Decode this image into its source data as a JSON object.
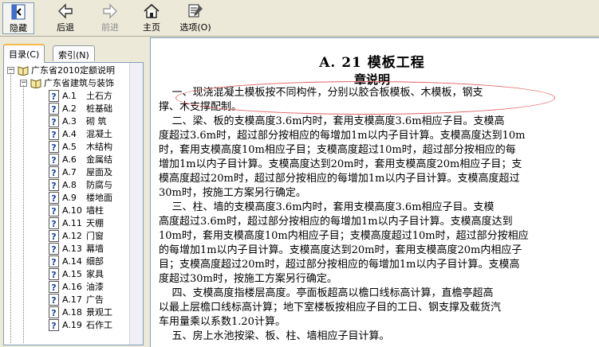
{
  "toolbar": {
    "hide": "隐藏",
    "back": "后退",
    "forward": "前进",
    "home": "主页",
    "options": "选项(O)"
  },
  "tabs": {
    "contents": "目录(C)",
    "index": "索引(N)"
  },
  "tree": {
    "root": "广东省2010定额说明",
    "child": "广东省建筑与装饰",
    "items": [
      {
        "code": "A.1",
        "label": "土石方"
      },
      {
        "code": "A.2",
        "label": "桩基础"
      },
      {
        "code": "A.3",
        "label": "砌  筑"
      },
      {
        "code": "A.4",
        "label": "混凝土"
      },
      {
        "code": "A.5",
        "label": "木结构"
      },
      {
        "code": "A.6",
        "label": "金属结"
      },
      {
        "code": "A.7",
        "label": "屋面及"
      },
      {
        "code": "A.8",
        "label": "防腐与"
      },
      {
        "code": "A.9",
        "label": "楼地面"
      },
      {
        "code": "A.10",
        "label": "墙柱"
      },
      {
        "code": "A.11",
        "label": "天棚"
      },
      {
        "code": "A.12",
        "label": "门窗"
      },
      {
        "code": "A.13",
        "label": "幕墙"
      },
      {
        "code": "A.14",
        "label": "细部"
      },
      {
        "code": "A.15",
        "label": "家具"
      },
      {
        "code": "A.16",
        "label": "油漆"
      },
      {
        "code": "A.17",
        "label": "广告"
      },
      {
        "code": "A.18",
        "label": "景观工"
      },
      {
        "code": "A.19",
        "label": "石作工"
      }
    ]
  },
  "document": {
    "title": "A. 21  模板工程",
    "subtitle": "章说明",
    "lines": [
      "    一、现浇混凝土模板按不同构件，分别以胶合板模板、木模板，钢支",
      "撑、木支撑配制。",
      "    二、梁、板的支模高度3.6m内时，套用支模高度3.6m相应子目。支模高",
      "度超过3.6m时，超过部分按相应的每增加1m以内子目计算。支模高度达到10m",
      "时，套用支模高度10m相应子目；支模高度超过10m时，超过部分按相应的每",
      "增加1m以内子目计算。支模高度达到20m时，套用支模高度20m相应子目；支",
      "模高度超过20m时，超过部分按相应的每增加1m以内子目计算。支模高度超过",
      "30m时，按施工方案另行确定。",
      "    三、柱、墙的支模高度3.6m内时，套用支模高度3.6m相应子目。支模",
      "高度超过3.6m时，超过部分按相应的每增加1m以内子目计算。支模高度达到",
      "10m时，套用支模高度10m内相应子目；支模高度超过10m时，超过部分按相应",
      "的每增加1m以内子目计算。支模高度达到20m时，套用支模高度20m内相应子",
      "目；支模高度超过20m时，超过部分按相应的每增加1m以内子目计算。支模高",
      "度超过30m时，按施工方案另行确定。",
      "    四、支模高度指楼层高度。亭面板超高以檐口线标高计算，直檐亭超高",
      "以最上层檐口线标高计算；地下室楼板按相应子目的工日、钢支撑及载货汽",
      "车用量乘以系数1.20计算。",
      "    五、房上水池按梁、板、柱、墙相应子目计算。"
    ]
  },
  "colors": {
    "highlight": "#e06060",
    "qicon": "#1a3fa0"
  }
}
